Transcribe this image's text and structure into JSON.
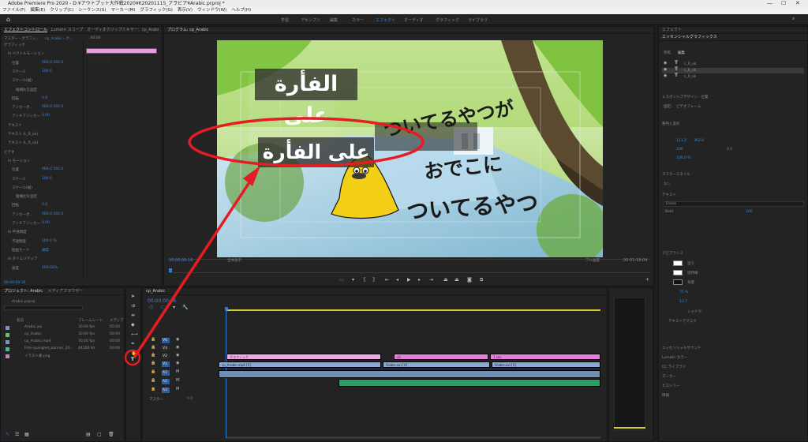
{
  "app": {
    "title": "Adobe Premiere Pro 2020 - D:¥アウトプット大作戦2020¥K20201115_アラビア¥Arabic.prproj *",
    "menu": [
      "ファイル(F)",
      "編集(E)",
      "クリップ(C)",
      "シーケンス(S)",
      "マーカー(M)",
      "グラフィック(G)",
      "表示(V)",
      "ウィンドウ(W)",
      "ヘルプ(H)"
    ],
    "workspaces": [
      "学習",
      "アセンブリ",
      "編集",
      "カラー",
      "エフェクト",
      "オーディオ",
      "グラフィック",
      "ライブラリ"
    ],
    "active_workspace": "エフェクト"
  },
  "effect_controls": {
    "tabs": [
      "エフェクトコントロール",
      "Lumetri スコープ",
      "オーディオクリップミキサー：cp_Arabi"
    ],
    "master": "マスター・グラフィ...",
    "sequence": "cp_Arabic・グ...",
    "timecode": ":00:00",
    "clip_label": "グラフィック",
    "rows": [
      {
        "label": "グラフィック",
        "indent": 0
      },
      {
        "label": "fx  ベクトルモーション",
        "indent": 1
      },
      {
        "label": "位置",
        "value": "960.0  540.0",
        "indent": 2
      },
      {
        "label": "スケール",
        "value": "100.0",
        "indent": 2
      },
      {
        "label": "スケール(幅)",
        "value": "",
        "indent": 2
      },
      {
        "label": "縦横比を固定",
        "value": "",
        "indent": 3
      },
      {
        "label": "回転",
        "value": "0.0",
        "indent": 2
      },
      {
        "label": "アンカーポ...",
        "value": "960.0  540.0",
        "indent": 2
      },
      {
        "label": "アンチフリッカー",
        "value": "0.00",
        "indent": 2
      },
      {
        "label": "テキスト",
        "indent": 1
      },
      {
        "label": "テキスト (L_R_ok)",
        "indent": 1
      },
      {
        "label": "テキスト (L_R_ok)",
        "indent": 1
      },
      {
        "label": "ビデオ",
        "indent": 0
      },
      {
        "label": "fx  モーション",
        "indent": 1
      },
      {
        "label": "位置",
        "value": "960.0  540.0",
        "indent": 2
      },
      {
        "label": "スケール",
        "value": "100.0",
        "indent": 2
      },
      {
        "label": "スケール(幅)",
        "value": "",
        "indent": 2
      },
      {
        "label": "縦横比を固定",
        "value": "",
        "indent": 3
      },
      {
        "label": "回転",
        "value": "0.0",
        "indent": 2
      },
      {
        "label": "アンカーポ...",
        "value": "960.0  540.0",
        "indent": 2
      },
      {
        "label": "アンチフリッカー",
        "value": "0.00",
        "indent": 2
      },
      {
        "label": "fx  不透明度",
        "indent": 1
      },
      {
        "label": "不透明度",
        "value": "100.0 %",
        "indent": 2
      },
      {
        "label": "描画モード",
        "value": "通常",
        "indent": 2
      },
      {
        "label": "fx  タイムリマップ",
        "indent": 1
      },
      {
        "label": "速度",
        "value": "100.00%",
        "indent": 2
      }
    ],
    "footer_time": "00:00:00:16"
  },
  "program_monitor": {
    "tab": "プログラム: cp_Arabic",
    "text_arabic_reversed": "ةرأفلا ىلع",
    "text_arabic": "على الفأرة",
    "text_jp_1": "ついてるやつが",
    "text_jp_2": "おでこに",
    "text_jp_3": "ついてるやつ",
    "timecode_left": "00:00:00:16",
    "fit_label": "全体表示",
    "quality": "フル画質",
    "timecode_right": "00:01:18:04"
  },
  "project": {
    "tabs": [
      "プロジェクト: Arabic",
      "メディアブラウザー"
    ],
    "project_file": "Arabic.prproj",
    "columns": [
      "名前",
      "フレームレート",
      "メディア"
    ],
    "items": [
      {
        "name": "Arabic.avi",
        "rate": "30.00 fps",
        "media": "00:00",
        "color": "#7a8fd8"
      },
      {
        "name": "cp_Arabic",
        "rate": "30.00 fps",
        "media": "00:00",
        "color": "#6fbf6a"
      },
      {
        "name": "cp_Arabic.mp4",
        "rate": "30.00 fps",
        "media": "00:00",
        "color": "#7a8fd8"
      },
      {
        "name": "Film-spangled_banner_20...",
        "rate": "44100 Hz",
        "media": "00:00",
        "color": "#3fbf8e"
      },
      {
        "name": "イラスト素.png",
        "rate": "",
        "media": "",
        "color": "#d879c8"
      }
    ]
  },
  "timeline": {
    "sequence_tab": "cp_Arabic",
    "timecode": "00:00:00:16",
    "tracks_video": [
      "V6",
      "V3",
      "V2",
      "V1"
    ],
    "tracks_audio": [
      "A1",
      "A2",
      "A3"
    ],
    "master_label": "マスター",
    "master_value": "0.0",
    "clips": {
      "graphic": "グラフィック",
      "graphic2": "ok",
      "graphic3": "1 ses",
      "v1_a": "cp_Arabic.mp4 [V]",
      "v1_b": "Arabic.avi [V]",
      "v1_c": "Arabic.avi [V]"
    }
  },
  "essential_graphics": {
    "tabs": [
      "エフェクト",
      "エッセンシャルグラフィックス"
    ],
    "subtabs": [
      "参照",
      "編集"
    ],
    "layers": [
      "L_R_ok",
      "L_R_ok",
      "L_R_ok"
    ],
    "responsive_label": "レスポンシブデザイン - 位置",
    "pin_label": "固定：",
    "pin_value": "ビデオフレーム",
    "align_label": "整列と変形",
    "values": [
      "111.2",
      "363.8",
      "100",
      "0.0",
      "100.0 %"
    ],
    "master_style_label": "マスタースタイル",
    "master_style_value": "なし",
    "text_label": "テキスト",
    "font": "Dubai",
    "weight": "Bold",
    "font_size": "100",
    "appearance_label": "アピアランス",
    "fill": "塗り",
    "stroke": "境界線",
    "background": "背景",
    "bg_opacity": "75 %",
    "bg_size": "13.7",
    "shadow": "シャドウ",
    "mask": "テキストでマスク",
    "sections": [
      "エッセンシャルサウンド",
      "Lumetri カラー",
      "CC ライブラリ",
      "マーカー",
      "ヒストリー",
      "情報"
    ]
  },
  "colors": {
    "accent_blue": "#2e7dd8",
    "annotation_red": "#e51c23",
    "graphic_clip": "#f2a7e8",
    "video_clip": "#8aa9d8",
    "audio_clip": "#2f9c64"
  }
}
